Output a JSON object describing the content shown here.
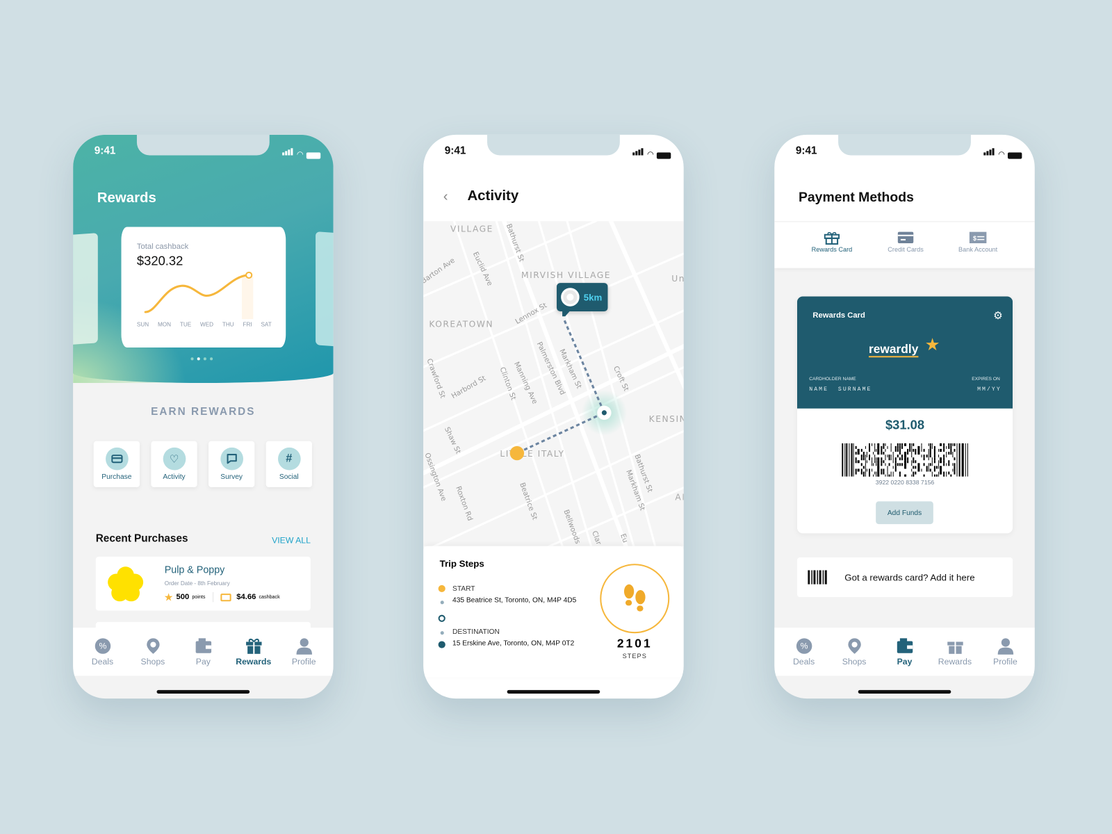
{
  "status_time": "9:41",
  "rewards_screen": {
    "title": "Rewards",
    "cashback_card": {
      "label": "Total cashback",
      "amount": "$320.32",
      "days": [
        "SUN",
        "MON",
        "TUE",
        "WED",
        "THU",
        "FRI",
        "SAT"
      ],
      "selected_day": "FRI"
    },
    "earn_title": "EARN REWARDS",
    "earn_items": [
      {
        "label": "Purchase",
        "icon": "card-icon"
      },
      {
        "label": "Activity",
        "icon": "heart-icon"
      },
      {
        "label": "Survey",
        "icon": "chat-icon"
      },
      {
        "label": "Social",
        "icon": "hashtag-icon"
      }
    ],
    "recent_title": "Recent Purchases",
    "view_all": "VIEW ALL",
    "purchase": {
      "merchant": "Pulp & Poppy",
      "order_date": "Order Date - 8th February",
      "points": "500",
      "points_unit": "points",
      "cashback": "$4.66",
      "cashback_unit": "cashback"
    }
  },
  "activity_screen": {
    "title": "Activity",
    "map": {
      "distance": "5km",
      "districts": [
        "VILLAGE",
        "MIRVISH VILLAGE",
        "KOREATOWN",
        "LITTLE ITALY",
        "KENSINGTON MARKET",
        "Uni",
        "AL"
      ],
      "streets": [
        "Bathurst St",
        "Euclid Ave",
        "Barton Ave",
        "Lennox St",
        "Crawford St",
        "Harbord St",
        "Clinton St",
        "Manning Ave",
        "Palmerston Blvd",
        "Markham St",
        "Croft St",
        "Shaw St",
        "Ossington Ave",
        "Roxton Rd",
        "Beatrice St",
        "Bellwoods Ave",
        "Bathurst St",
        "Markham St",
        "Clar",
        "Eu"
      ]
    },
    "trip_title": "Trip Steps",
    "start_label": "START",
    "start_address": "435 Beatrice St, Toronto, ON, M4P 4D5",
    "destination_label": "DESTINATION",
    "destination_address": "15 Erskine Ave, Toronto, ON, M4P 0T2",
    "steps": "2101",
    "steps_label": "STEPS"
  },
  "payment_screen": {
    "title": "Payment Methods",
    "tabs": [
      {
        "label": "Rewards Card",
        "icon": "gift-icon",
        "active": true
      },
      {
        "label": "Credit Cards",
        "icon": "credit-card-icon"
      },
      {
        "label": "Bank Account",
        "icon": "bank-icon"
      }
    ],
    "card": {
      "title": "Rewards Card",
      "brand": "rewardly",
      "holder_label": "CARDHOLDER NAME",
      "holder": "NAME  SURNAME",
      "expires_label": "EXPIRES ON",
      "expires": "MM/YY",
      "balance": "$31.08",
      "barcode_number": "3922 0220 8338 7156",
      "add_funds": "Add Funds"
    },
    "add_card": "Got a rewards card? Add it here"
  },
  "nav": [
    {
      "label": "Deals",
      "icon": "percent-badge-icon"
    },
    {
      "label": "Shops",
      "icon": "map-pin-icon"
    },
    {
      "label": "Pay",
      "icon": "wallet-icon"
    },
    {
      "label": "Rewards",
      "icon": "gift-icon"
    },
    {
      "label": "Profile",
      "icon": "user-icon"
    }
  ],
  "colors": {
    "teal_dark": "#1f5b6e",
    "accent_yellow": "#f6b73c",
    "nav_inactive": "#8a9aae",
    "link_blue": "#1fa3c9"
  }
}
